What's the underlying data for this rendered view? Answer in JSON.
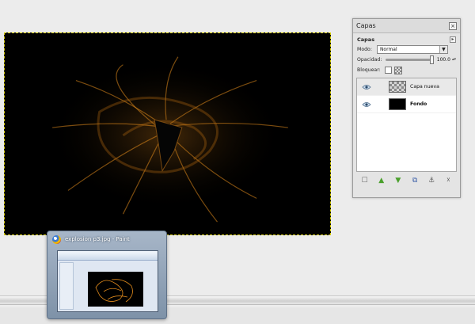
{
  "canvas": {
    "background": "#000000",
    "glow_color": "#e08a1c"
  },
  "layers_dialog": {
    "title": "Capas",
    "close_symbol": "×",
    "tab_label": "Capas",
    "tab_menu_symbol": "▸",
    "mode_label": "Modo:",
    "mode_value": "Normal",
    "mode_arrow": "▼",
    "opacity_label": "Opacidad:",
    "opacity_value": "100.0",
    "opacity_fraction": 1.0,
    "spin_symbol": "▴▾",
    "lock_label": "Bloquear:",
    "layers": [
      {
        "name": "Capa nueva",
        "thumbnail": "transparent-checker",
        "selected": true,
        "visible": true
      },
      {
        "name": "Fondo",
        "thumbnail": "black",
        "selected": false,
        "visible": true
      }
    ],
    "footer_icons": [
      {
        "name": "new-layer-icon",
        "glyph": "☐",
        "color": "#666666"
      },
      {
        "name": "raise-layer-icon",
        "glyph": "▲",
        "color": "#4aa02c"
      },
      {
        "name": "lower-layer-icon",
        "glyph": "▼",
        "color": "#4aa02c"
      },
      {
        "name": "duplicate-layer-icon",
        "glyph": "⧉",
        "color": "#3a5ea8"
      },
      {
        "name": "anchor-layer-icon",
        "glyph": "⚓",
        "color": "#555555"
      },
      {
        "name": "delete-layer-icon",
        "glyph": "☓",
        "color": "#555555"
      }
    ]
  },
  "taskbar_preview": {
    "title": "explosion p3.jpg - Paint",
    "app_icon": "paint-icon"
  }
}
